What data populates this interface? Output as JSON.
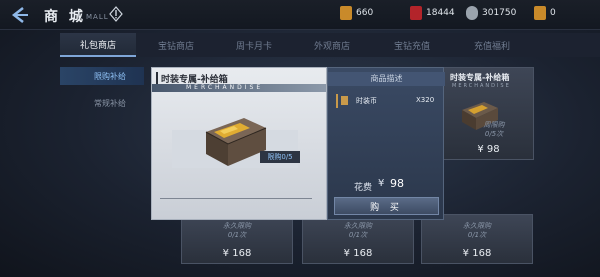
{
  "header": {
    "back_label": "<",
    "title": "商 城",
    "title_en": "MALL",
    "resources": [
      {
        "icon": "gold-bar-icon",
        "value": "660",
        "color": "#c98a2a"
      },
      {
        "icon": "red-gem-icon",
        "value": "18444",
        "color": "#b3242a"
      },
      {
        "icon": "silver-coin-icon",
        "value": "301750",
        "color": "#9aa3ad"
      },
      {
        "icon": "gold-token-icon",
        "value": "0",
        "color": "#c98a2a"
      }
    ]
  },
  "tabs": [
    {
      "label": "礼包商店",
      "active": true
    },
    {
      "label": "宝钻商店"
    },
    {
      "label": "周卡月卡"
    },
    {
      "label": "外观商店"
    },
    {
      "label": "宝钻充值"
    },
    {
      "label": "充值福利"
    }
  ],
  "side_menu": [
    {
      "label": "限购补给",
      "active": true
    },
    {
      "label": "常规补给"
    }
  ],
  "cards": {
    "right": {
      "title": "时装专属-补给箱",
      "subtitle": "MERCHANDISE",
      "limit": "周限购",
      "count": "0/5次",
      "price": "¥ 98"
    },
    "bottom": [
      {
        "limit": "永久限购",
        "count": "0/1次",
        "price": "¥ 168"
      },
      {
        "limit": "永久限购",
        "count": "0/1次",
        "price": "¥ 168"
      },
      {
        "limit": "永久限购",
        "count": "0/1次",
        "price": "¥ 168"
      }
    ]
  },
  "popup": {
    "title": "时装专属-补给箱",
    "subtitle": "MERCHANDISE",
    "limit_badge": "限购0/5",
    "desc_header": "商品描述",
    "item_name": "时装币",
    "item_qty": "X320",
    "cost_label": "花费",
    "cost_currency": "¥",
    "cost_value": "98",
    "buy_label": "购 买"
  }
}
